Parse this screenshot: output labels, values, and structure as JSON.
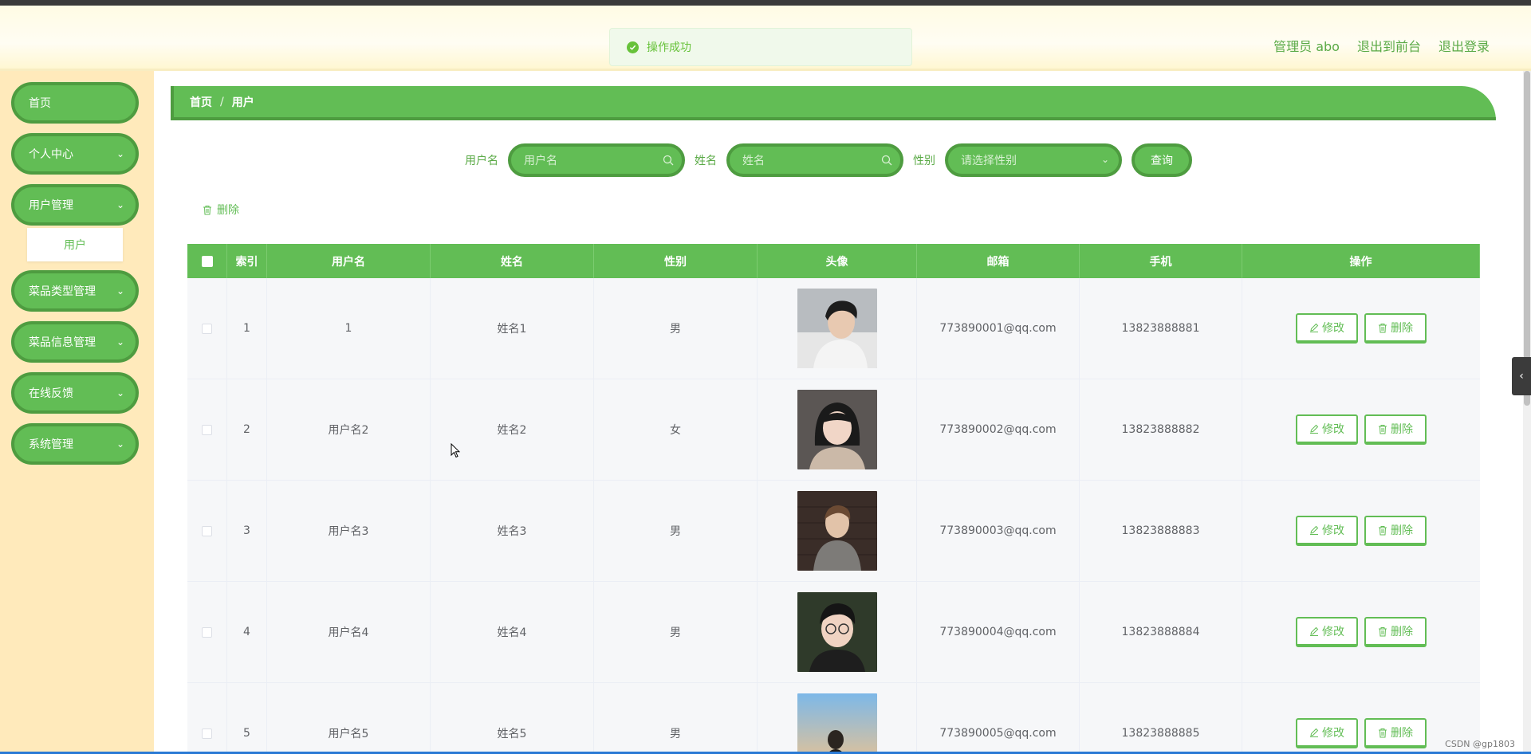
{
  "toast": {
    "text": "操作成功"
  },
  "header": {
    "links": [
      "管理员 abo",
      "退出到前台",
      "退出登录"
    ]
  },
  "sidebar": {
    "items": [
      {
        "label": "首页",
        "has_children": false
      },
      {
        "label": "个人中心",
        "has_children": true
      },
      {
        "label": "用户管理",
        "has_children": true
      },
      {
        "label": "菜品类型管理",
        "has_children": true
      },
      {
        "label": "菜品信息管理",
        "has_children": true
      },
      {
        "label": "在线反馈",
        "has_children": true
      },
      {
        "label": "系统管理",
        "has_children": true
      }
    ],
    "submenu": {
      "label": "用户"
    }
  },
  "breadcrumb": {
    "home": "首页",
    "separator": "/",
    "current": "用户"
  },
  "search": {
    "username_label": "用户名",
    "username_placeholder": "用户名",
    "name_label": "姓名",
    "name_placeholder": "姓名",
    "gender_label": "性别",
    "gender_placeholder": "请选择性别",
    "query_button": "查询"
  },
  "actions": {
    "delete_label": "删除"
  },
  "table": {
    "headers": [
      "索引",
      "用户名",
      "姓名",
      "性别",
      "头像",
      "邮箱",
      "手机",
      "操作"
    ],
    "edit_label": "修改",
    "delete_label": "删除",
    "rows": [
      {
        "index": "1",
        "username": "1",
        "name": "姓名1",
        "gender": "男",
        "email": "773890001@qq.com",
        "phone": "13823888881"
      },
      {
        "index": "2",
        "username": "用户名2",
        "name": "姓名2",
        "gender": "女",
        "email": "773890002@qq.com",
        "phone": "13823888882"
      },
      {
        "index": "3",
        "username": "用户名3",
        "name": "姓名3",
        "gender": "男",
        "email": "773890003@qq.com",
        "phone": "13823888883"
      },
      {
        "index": "4",
        "username": "用户名4",
        "name": "姓名4",
        "gender": "男",
        "email": "773890004@qq.com",
        "phone": "13823888884"
      },
      {
        "index": "5",
        "username": "用户名5",
        "name": "姓名5",
        "gender": "男",
        "email": "773890005@qq.com",
        "phone": "13823888885"
      }
    ]
  },
  "watermark": "CSDN @gp1803",
  "colors": {
    "primary": "#62bd55",
    "primary_dark": "#4e9c40",
    "sidebar_bg": "#ffeabb",
    "header_bg": "#fffbe4"
  }
}
